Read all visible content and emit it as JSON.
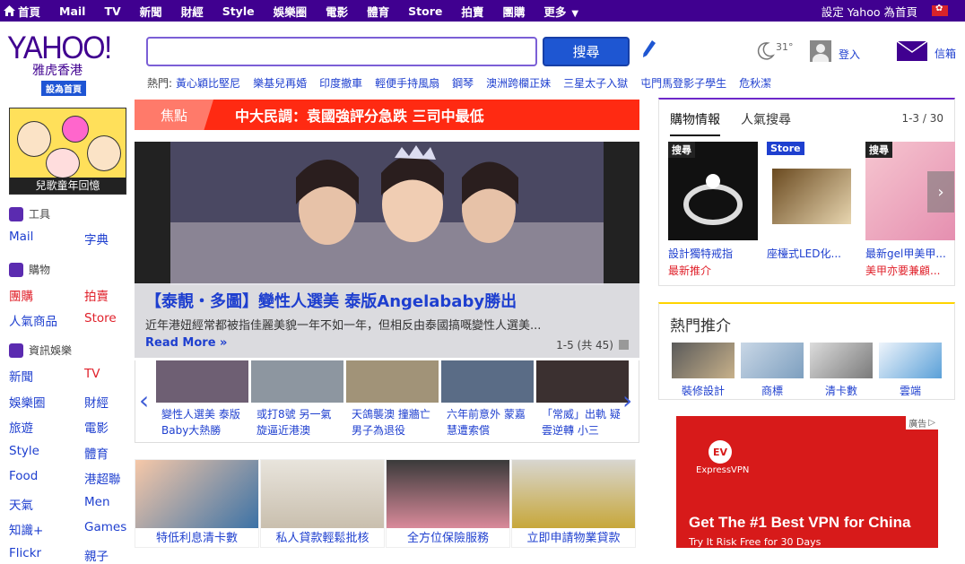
{
  "topnav": {
    "items": [
      "首頁",
      "Mail",
      "TV",
      "新聞",
      "財經",
      "Style",
      "娛樂圈",
      "電影",
      "體育",
      "Store",
      "拍賣",
      "團購",
      "更多"
    ],
    "setting": "設定 Yahoo 為首頁"
  },
  "logo": {
    "brand": "YAHOO!",
    "region": "雅虎香港",
    "sethome": "設為首頁"
  },
  "search": {
    "value": "",
    "button": "搜尋"
  },
  "hot": {
    "label": "熱門:",
    "terms": [
      "黃心穎比堅尼",
      "樂基兒再婚",
      "印度撤車",
      "輕便手持風扇",
      "鋼琴",
      "澳洲跨欄正妹",
      "三星太子入獄",
      "屯門馬登影子學生",
      "危秋潔"
    ]
  },
  "weather": {
    "temp": "31°"
  },
  "user": {
    "login": "登入",
    "mail": "信箱"
  },
  "promo": {
    "caption": "兒歌童年回憶"
  },
  "sections": {
    "tools": {
      "title": "工具",
      "items": [
        "Mail",
        "字典"
      ]
    },
    "shopping": {
      "title": "購物",
      "items": [
        "團購",
        "拍賣",
        "人氣商品",
        "Store"
      ]
    },
    "info": {
      "title": "資訊娛樂",
      "items": [
        "新聞",
        "TV",
        "娛樂圈",
        "財經",
        "旅遊",
        "電影",
        "Style",
        "體育",
        "Food",
        "港超聯",
        "天氣",
        "Men",
        "知識+",
        "Games",
        "Flickr",
        "親子"
      ]
    }
  },
  "focus": {
    "tag": "焦點",
    "headline": "中大民調：袁國強評分急跌 三司中最低"
  },
  "hero": {
    "title": "【泰靚・多圖】變性人選美 泰版Angelababy勝出",
    "desc": "近年港妞經常都被指佳麗美貌一年不如一年，但相反由泰國搞嘅變性人選美...",
    "more": "Read More »",
    "pager": "1-5 (共 45)"
  },
  "strip": {
    "items": [
      "變性人選美 泰版Baby大熱勝",
      "或打8號 另一氣旋逼近港澳",
      "天鴿襲澳 撞牆亡男子為退役",
      "六年前意外 蒙嘉慧遭索償",
      "「常威」出軌 疑雲逆轉 小三"
    ]
  },
  "bottomcards": [
    "特低利息清卡數",
    "私人貸款輕鬆批核",
    "全方位保險服務",
    "立即申請物業貸款"
  ],
  "shop": {
    "tabs": [
      "購物情報",
      "人氣搜尋"
    ],
    "count": "1-3 / 30",
    "products": [
      {
        "badge": "搜尋",
        "name": "設計獨特戒指",
        "sub": "最新推介"
      },
      {
        "badge": "Store",
        "name": "座檯式LED化...",
        "sub": ""
      },
      {
        "badge": "搜尋",
        "name": "最新gel甲美甲...",
        "sub": "美甲亦要兼顧..."
      }
    ]
  },
  "hotrec": {
    "title": "熱門推介",
    "items": [
      "裝修設計",
      "商標",
      "清卡數",
      "雲端"
    ]
  },
  "ad": {
    "tag": "廣告",
    "brand": "ExpressVPN",
    "headline": "Get The #1 Best VPN for China",
    "sub": "Try It Risk Free for 30 Days"
  },
  "colors": {
    "brand": "#400090",
    "link": "#1e3fcf",
    "accent_red": "#e0202a",
    "search_btn": "#1e56d2",
    "focus_bg": "#ff2a12"
  }
}
